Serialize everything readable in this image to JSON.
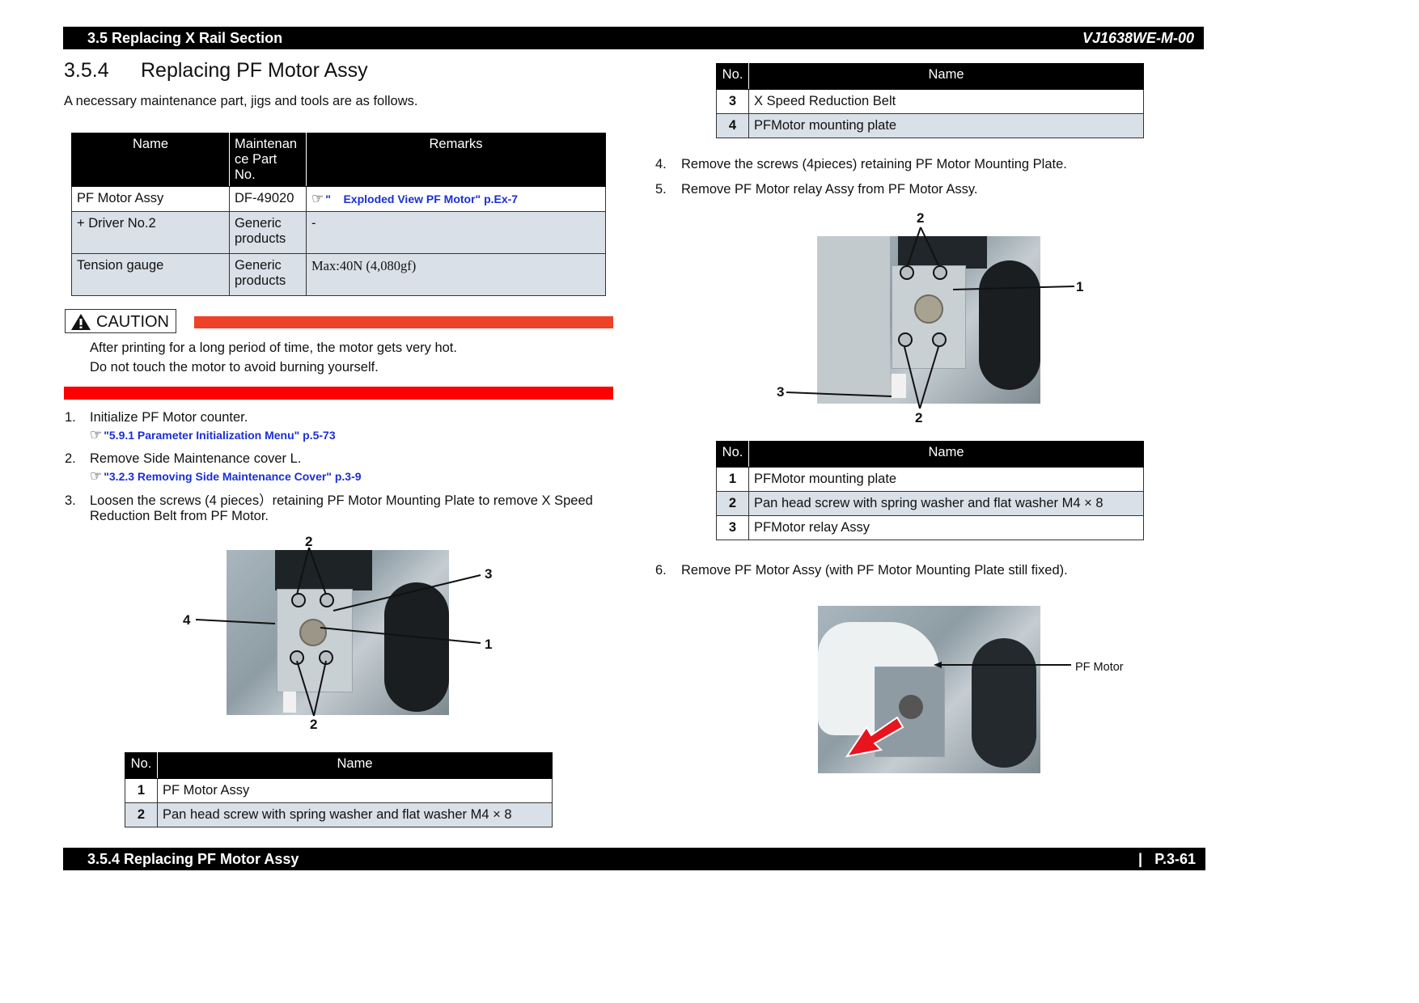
{
  "header": {
    "section": "3.5 Replacing X Rail Section",
    "doc_code": "VJ1638WE-M-00"
  },
  "footer": {
    "section": "3.5.4 Replacing PF Motor Assy",
    "page": "P.3-61",
    "separator": "|"
  },
  "title": {
    "number": "3.5.4",
    "text": "Replacing PF Motor Assy"
  },
  "intro": "A necessary maintenance part, jigs and tools are as follows.",
  "parts_table": {
    "headers": [
      "Name",
      "Maintenan ce Part No.",
      "Remarks"
    ],
    "rows": [
      {
        "name": "PF Motor Assy",
        "part_no": "DF-49020",
        "remarks_icon": "pointing-hand-icon",
        "remarks_link": "\"    Exploded View PF Motor\" p.Ex-7"
      },
      {
        "name": "+ Driver No.2",
        "part_no": "Generic products",
        "remarks": "-"
      },
      {
        "name": "Tension gauge",
        "part_no": "Generic products",
        "remarks": "Max:40N (4,080gf)"
      }
    ]
  },
  "caution": {
    "label": "CAUTION",
    "icon": "warning-triangle-icon",
    "lines": [
      "After printing for a long period of time, the motor gets very hot.",
      "Do not touch the motor to avoid burning yourself."
    ],
    "colors": {
      "top_bar": "#ee4127",
      "bottom_bar": "#ff0000"
    }
  },
  "steps": [
    {
      "num": "1.",
      "text": "Initialize PF Motor counter.",
      "ref": "\"5.9.1 Parameter Initialization Menu\" p.5-73"
    },
    {
      "num": "2.",
      "text": "Remove Side Maintenance cover L.",
      "ref": "\"3.2.3 Removing Side Maintenance Cover\" p.3-9"
    },
    {
      "num": "3.",
      "text": "Loosen the screws (4 pieces）retaining PF Motor Mounting Plate to remove X Speed Reduction Belt from PF Motor."
    },
    {
      "num": "4.",
      "text": "Remove the screws (4pieces) retaining PF Motor Mounting Plate."
    },
    {
      "num": "5.",
      "text": "Remove PF Motor relay Assy from PF Motor Assy."
    },
    {
      "num": "6.",
      "text": "Remove PF Motor Assy (with PF Motor Mounting Plate still fixed)."
    }
  ],
  "figure1": {
    "callouts": {
      "top": "2",
      "bottom": "2",
      "left": "4",
      "right_top": "3",
      "right_mid": "1"
    }
  },
  "table1": {
    "headers": [
      "No.",
      "Name"
    ],
    "rows": [
      {
        "no": "1",
        "name": "PF Motor Assy"
      },
      {
        "no": "2",
        "name": "Pan head screw with spring washer and flat washer M4 × 8"
      }
    ]
  },
  "table2": {
    "headers": [
      "No.",
      "Name"
    ],
    "rows": [
      {
        "no": "3",
        "name": "X Speed Reduction Belt"
      },
      {
        "no": "4",
        "name": "PFMotor mounting plate"
      }
    ]
  },
  "figure2": {
    "callouts": {
      "top": "2",
      "bottom": "2",
      "right": "1",
      "left": "3"
    }
  },
  "table3": {
    "headers": [
      "No.",
      "Name"
    ],
    "rows": [
      {
        "no": "1",
        "name": "PFMotor mounting plate"
      },
      {
        "no": "2",
        "name": "Pan head screw with spring washer and flat washer M4 × 8"
      },
      {
        "no": "3",
        "name": "PFMotor relay Assy"
      }
    ]
  },
  "figure3": {
    "label": "PF Motor",
    "arrow_color": "#e8141e"
  }
}
